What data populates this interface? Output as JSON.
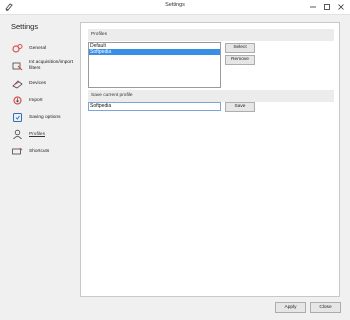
{
  "window": {
    "title": "Settings"
  },
  "sidebar": {
    "title": "Settings",
    "items": [
      {
        "label": "General",
        "icon": "gears-icon"
      },
      {
        "label": "Int acquisition/import filters",
        "icon": "filter-icon"
      },
      {
        "label": "Devices",
        "icon": "devices-icon"
      },
      {
        "label": "Import",
        "icon": "import-icon"
      },
      {
        "label": "Saving options",
        "icon": "save-options-icon"
      },
      {
        "label": "Profiles",
        "icon": "profile-icon"
      },
      {
        "label": "Shortcuts",
        "icon": "keyboard-icon"
      }
    ],
    "active_index": 5
  },
  "profiles": {
    "heading": "Profiles",
    "items": [
      "Default",
      "Softpedia"
    ],
    "selected_index": 1,
    "select_label": "Select",
    "remove_label": "Remove"
  },
  "save_profile": {
    "heading": "Save current profile",
    "value": "Softpedia",
    "save_label": "Save"
  },
  "footer": {
    "apply_label": "Apply",
    "close_label": "Close"
  },
  "colors": {
    "selection": "#3a8ee6",
    "accent_red": "#d9534f",
    "accent_blue": "#2f6fbf"
  }
}
